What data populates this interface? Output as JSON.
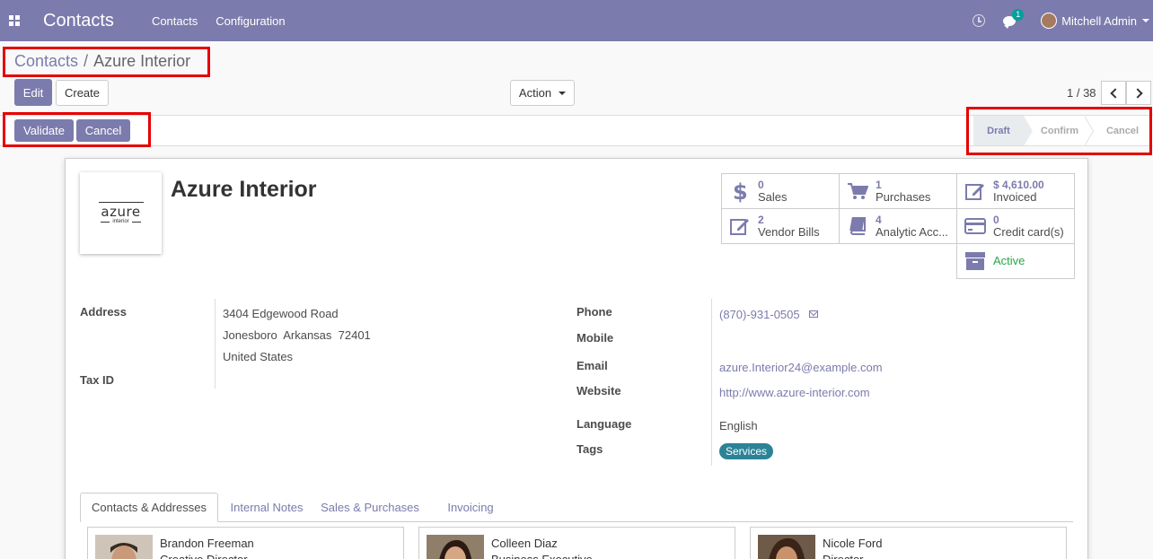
{
  "navbar": {
    "app_title": "Contacts",
    "menus": [
      "Contacts",
      "Configuration"
    ],
    "chat_count": "1",
    "user_name": "Mitchell Admin"
  },
  "breadcrumb": {
    "parent": "Contacts",
    "separator": "/",
    "current": "Azure Interior"
  },
  "buttons": {
    "edit": "Edit",
    "create": "Create",
    "action": "Action"
  },
  "pager": {
    "value": "1 / 38"
  },
  "statusbar": {
    "validate": "Validate",
    "cancel": "Cancel",
    "stages": [
      "Draft",
      "Confirm",
      "Cancel"
    ],
    "current_stage": "Draft"
  },
  "partner": {
    "name": "Azure Interior",
    "logo_text": "azure",
    "logo_subtext": "interior"
  },
  "smart_buttons": [
    {
      "value": "0",
      "label": "Sales",
      "icon": "dollar-icon"
    },
    {
      "value": "1",
      "label": "Purchases",
      "icon": "cart-icon"
    },
    {
      "value": "$ 4,610.00",
      "label": "Invoiced",
      "icon": "edit-icon"
    },
    {
      "value": "2",
      "label": "Vendor Bills",
      "icon": "edit-icon"
    },
    {
      "value": "4",
      "label": "Analytic Acc...",
      "icon": "book-icon"
    },
    {
      "value": "0",
      "label": "Credit card(s)",
      "icon": "credit-card-icon"
    },
    {
      "value": "",
      "label": "Active",
      "icon": "archive-icon"
    }
  ],
  "fields": {
    "address_label": "Address",
    "street": "3404 Edgewood Road",
    "city_line": "Jonesboro  Arkansas  72401",
    "country": "United States",
    "tax_id_label": "Tax ID",
    "phone_label": "Phone",
    "phone": "(870)-931-0505",
    "mobile_label": "Mobile",
    "email_label": "Email",
    "email": "azure.Interior24@example.com",
    "website_label": "Website",
    "website": "http://www.azure-interior.com",
    "language_label": "Language",
    "language": "English",
    "tags_label": "Tags",
    "tag": "Services"
  },
  "tabs": [
    "Contacts & Addresses",
    "Internal Notes",
    "Sales & Purchases",
    "Invoicing"
  ],
  "contacts": [
    {
      "name": "Brandon Freeman",
      "role": "Creative Director"
    },
    {
      "name": "Colleen Diaz",
      "role": "Business Executive"
    },
    {
      "name": "Nicole Ford",
      "role": "Director"
    }
  ],
  "colors": {
    "brand": "#7c7bad",
    "active_green": "#28a745",
    "tag_bg": "#2c8397",
    "highlight_red": "#e60000"
  }
}
